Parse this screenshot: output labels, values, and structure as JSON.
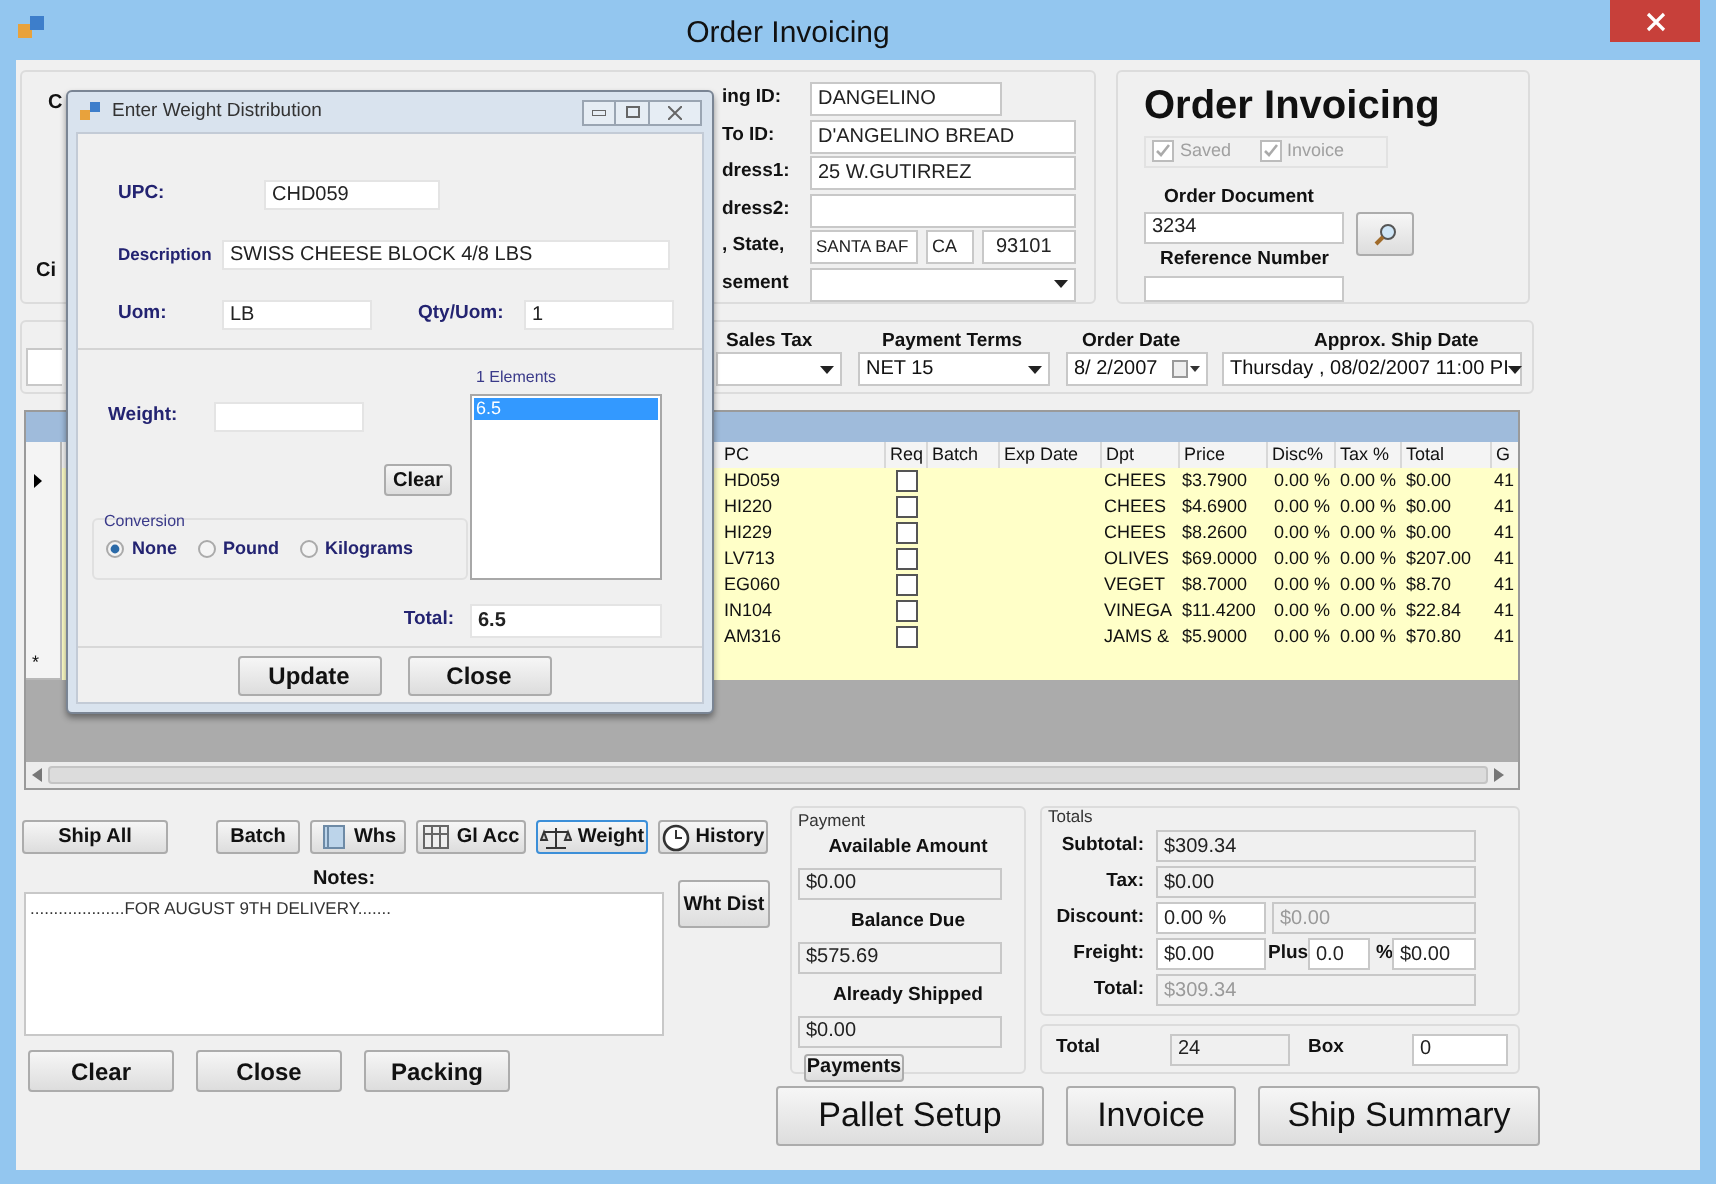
{
  "window": {
    "title": "Order Invoicing"
  },
  "customer": {
    "hidden_labels": [
      "C",
      "Ci"
    ],
    "fields": [
      {
        "label": "ing ID:",
        "kind": "text",
        "value": "DANGELINO"
      },
      {
        "label": "To ID:",
        "kind": "text",
        "value": "D'ANGELINO BREAD"
      },
      {
        "label": "dress1:",
        "kind": "text",
        "value": "25 W.GUTIRREZ"
      },
      {
        "label": "dress2:",
        "kind": "text"
      },
      {
        "label": ", State,",
        "kind": "city",
        "parts": [
          "SANTA BAF",
          "CA",
          "93101"
        ]
      },
      {
        "label": "sement",
        "kind": "combo"
      }
    ]
  },
  "header": {
    "title": "Order Invoicing",
    "flags": [
      {
        "label": "Saved",
        "checked": true,
        "disabled": true
      },
      {
        "label": "Invoice",
        "checked": true,
        "disabled": true
      }
    ],
    "order_document": {
      "label": "Order Document",
      "value": "3234"
    },
    "reference_number": {
      "label": "Reference Number"
    }
  },
  "terms": {
    "sales_tax": {
      "label": "Sales Tax"
    },
    "payment_terms": {
      "label": "Payment Terms",
      "value": "NET 15"
    },
    "order_date": {
      "label": "Order Date",
      "value": "8/ 2/2007"
    },
    "ship_date": {
      "label": "Approx. Ship Date",
      "value": "Thursday , 08/02/2007 11:00 PI"
    }
  },
  "grid": {
    "columns": [
      "PC",
      "Req",
      "Batch",
      "Exp Date",
      "Dpt",
      "Price",
      "Disc%",
      "Tax %",
      "Total",
      "G"
    ],
    "new_row_marker": "*",
    "rows": [
      {
        "current": true,
        "req": false,
        "upc": "HD059",
        "dpt": "CHEES",
        "price": "$3.7900",
        "disc": "0.00 %",
        "tax": "0.00 %",
        "total": "$0.00",
        "g": "41"
      },
      {
        "current": false,
        "req": false,
        "upc": "HI220",
        "dpt": "CHEES",
        "price": "$4.6900",
        "disc": "0.00 %",
        "tax": "0.00 %",
        "total": "$0.00",
        "g": "41"
      },
      {
        "current": false,
        "req": false,
        "upc": "HI229",
        "dpt": "CHEES",
        "price": "$8.2600",
        "disc": "0.00 %",
        "tax": "0.00 %",
        "total": "$0.00",
        "g": "41"
      },
      {
        "current": false,
        "req": false,
        "upc": "LV713",
        "dpt": "OLIVES",
        "price": "$69.0000",
        "disc": "0.00 %",
        "tax": "0.00 %",
        "total": "$207.00",
        "g": "41"
      },
      {
        "current": false,
        "req": false,
        "upc": "EG060",
        "dpt": "VEGET",
        "price": "$8.7000",
        "disc": "0.00 %",
        "tax": "0.00 %",
        "total": "$8.70",
        "g": "41"
      },
      {
        "current": false,
        "req": false,
        "upc": "IN104",
        "dpt": "VINEGA",
        "price": "$11.4200",
        "disc": "0.00 %",
        "tax": "0.00 %",
        "total": "$22.84",
        "g": "41"
      },
      {
        "current": false,
        "req": false,
        "upc": "AM316",
        "dpt": "JAMS &",
        "price": "$5.9000",
        "disc": "0.00 %",
        "tax": "0.00 %",
        "total": "$70.80",
        "g": "41"
      }
    ]
  },
  "actions": [
    {
      "label": "Ship All",
      "kind": "plain",
      "focused": false
    },
    {
      "label": "Batch",
      "kind": "plain",
      "focused": false
    },
    {
      "label": "Whs",
      "kind": "book",
      "focused": false
    },
    {
      "label": "Gl Acc",
      "kind": "columns",
      "focused": false
    },
    {
      "label": "Weight",
      "kind": "scale",
      "focused": true
    },
    {
      "label": "History",
      "kind": "clock",
      "focused": false
    }
  ],
  "notes": {
    "label": "Notes:",
    "value": "....................FOR AUGUST 9TH DELIVERY......."
  },
  "wht_dist": "Wht Dist",
  "bottom_buttons": [
    "Clear",
    "Close",
    "Packing"
  ],
  "payment": {
    "title": "Payment",
    "items": [
      {
        "label": "Available Amount",
        "value": "$0.00"
      },
      {
        "label": "Balance Due",
        "value": "$575.69"
      },
      {
        "label": "Already Shipped",
        "value": "$0.00"
      }
    ],
    "button": "Payments"
  },
  "totals": {
    "title": "Totals",
    "subtotal": {
      "label": "Subtotal:",
      "value": "$309.34"
    },
    "tax": {
      "label": "Tax:",
      "value": "$0.00"
    },
    "discount": {
      "label": "Discount:",
      "value": "0.00 %",
      "amount": "$0.00"
    },
    "freight": {
      "label": "Freight:",
      "value": "$0.00",
      "plus_label": "Plus",
      "plus_value": "0.0",
      "percent_label": "%",
      "plus_amount": "$0.00"
    },
    "total": {
      "label": "Total:",
      "value": "$309.34"
    }
  },
  "boxes": {
    "total_label": "Total",
    "total_value": "24",
    "box_label": "Box",
    "box_value": "0"
  },
  "main_buttons": [
    "Pallet Setup",
    "Invoice",
    "Ship Summary"
  ],
  "dialog": {
    "title": "Enter Weight Distribution",
    "upc": {
      "label": "UPC:",
      "value": "CHD059"
    },
    "description": {
      "label": "Description",
      "value": "SWISS CHEESE BLOCK 4/8 LBS"
    },
    "uom": {
      "label": "Uom:",
      "value": "LB"
    },
    "qty_uom": {
      "label": "Qty/Uom:",
      "value": "1"
    },
    "elements_label": "1 Elements",
    "elements": [
      {
        "value": "6.5",
        "selected": true
      }
    ],
    "weight": {
      "label": "Weight:"
    },
    "clear": "Clear",
    "conversion": {
      "title": "Conversion",
      "options": [
        {
          "label": "None",
          "selected": true
        },
        {
          "label": "Pound",
          "selected": false
        },
        {
          "label": "Kilograms",
          "selected": false
        }
      ]
    },
    "total": {
      "label": "Total:",
      "value": "6.5"
    },
    "buttons": [
      "Update",
      "Close"
    ]
  }
}
